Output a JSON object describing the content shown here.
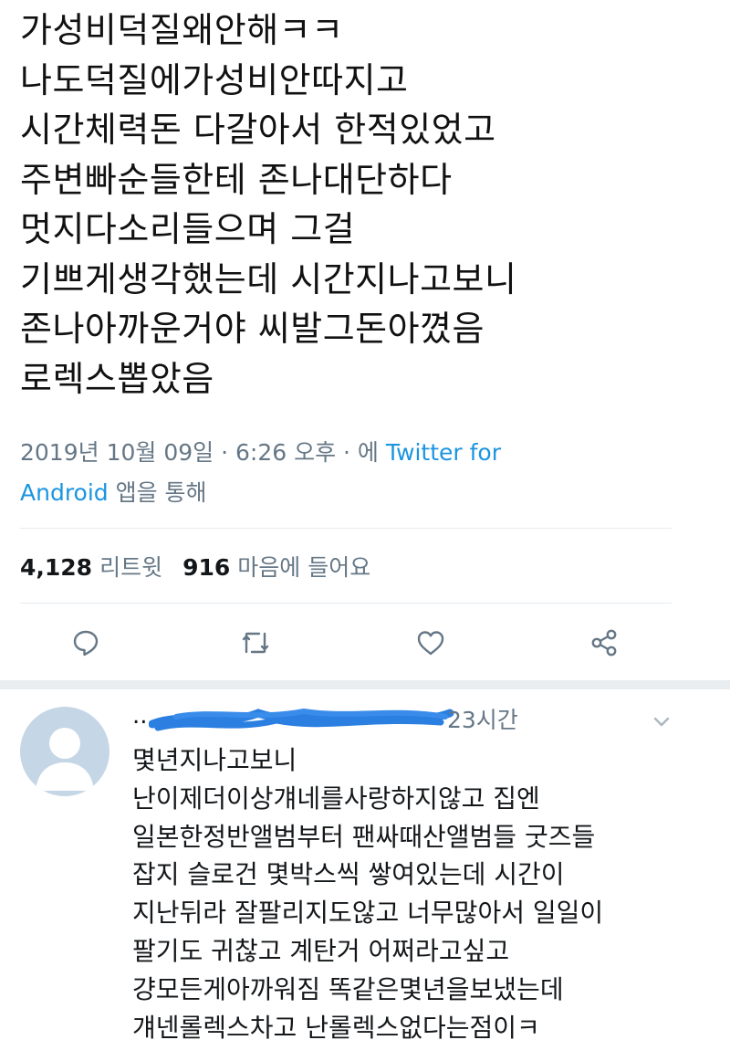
{
  "tweet": {
    "lines": [
      "가성비덕질왜안해ㅋㅋ",
      "나도덕질에가성비안따지고",
      "시간체력돈 다갈아서 한적있었고",
      "주변빠순들한테 존나대단하다",
      "멋지다소리들으며 그걸",
      "기쁘게생각했는데 시간지나고보니",
      "존나아까운거야 씨발그돈아꼈음",
      "로렉스뽑았음"
    ],
    "meta": {
      "date": "2019년 10월 09일",
      "separator1": " · ",
      "time": "6:26 오후",
      "separator2": " · ",
      "prefix": "에 ",
      "source_line1": "Twitter for",
      "source_line2": "Android",
      "suffix": " 앱을 통해"
    },
    "stats": {
      "retweets_count": "4,128",
      "retweets_label": "리트윗",
      "likes_count": "916",
      "likes_label": "마음에 들어요"
    },
    "actions": {
      "reply_icon": "speech-bubble-icon",
      "retweet_icon": "retweet-icon",
      "like_icon": "heart-icon",
      "share_icon": "share-icon"
    }
  },
  "reply": {
    "username_prefix": "..",
    "time": "23시간",
    "lines": [
      "몇년지나고보니",
      "난이제더이상걔네를사랑하지않고 집엔",
      "일본한정반앨범부터 팬싸때산앨범들 굿즈들",
      "잡지 슬로건 몇박스씩 쌓여있는데 시간이",
      "지난뒤라 잘팔리지도않고 너무많아서 일일이",
      "팔기도 귀찮고 계탄거 어쩌라고싶고",
      "걍모든게아까워짐 똑같은몇년을보냈는데",
      "걔넨롤렉스차고 난롤렉스없다는점이ㅋ"
    ]
  },
  "colors": {
    "text": "#14171a",
    "secondary": "#657786",
    "link": "#1b95e0",
    "scribble": "#2a7fe0",
    "avatar_bg": "#c5d6e6",
    "band": "#e9edf0"
  }
}
